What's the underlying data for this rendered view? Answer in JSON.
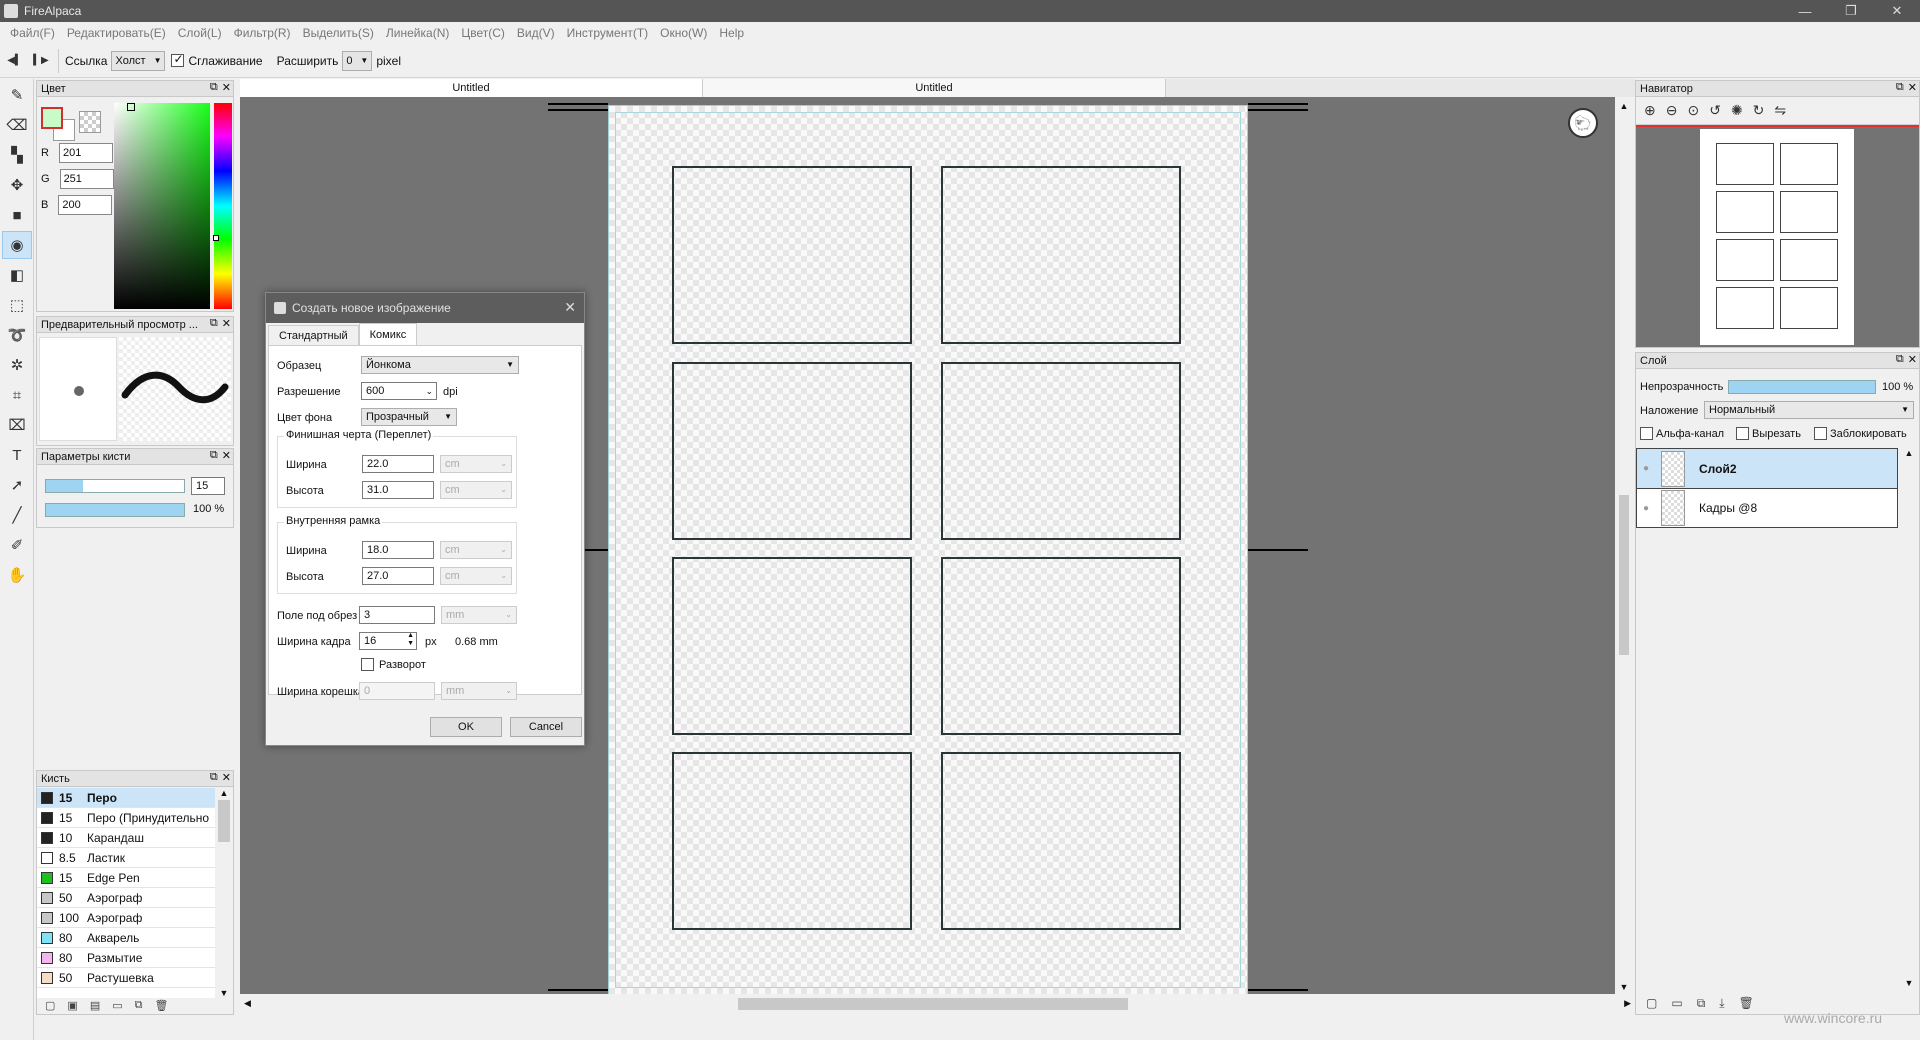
{
  "window": {
    "title": "FireAlpaca",
    "minimize": "—",
    "restore": "❐",
    "close": "✕"
  },
  "menu": [
    "Файл(F)",
    "Редактировать(E)",
    "Слой(L)",
    "Фильтр(R)",
    "Выделить(S)",
    "Линейка(N)",
    "Цвет(C)",
    "Вид(V)",
    "Инструмент(T)",
    "Окно(W)",
    "Help"
  ],
  "tool_options": {
    "ref_label": "Ссылка",
    "ref_value": "Холст",
    "antialias_label": "Сглаживание",
    "antialias_checked": true,
    "expand_label": "Расширить",
    "expand_value": "0",
    "unit": "pixel"
  },
  "color_panel": {
    "title": "Цвет",
    "r_label": "R",
    "r": "201",
    "g_label": "G",
    "g": "251",
    "b_label": "B",
    "b": "200",
    "fg_color": "#c9fbc8"
  },
  "preview_panel": {
    "title": "Предварительный просмотр ..."
  },
  "brush_params": {
    "title": "Параметры кисти",
    "size": "15",
    "opacity": "100 %",
    "size_fraction": 0.27,
    "opacity_fraction": 1.0
  },
  "brush_panel": {
    "title": "Кисть",
    "items": [
      {
        "size": "15",
        "name": "Перо",
        "color": "#222222",
        "selected": true
      },
      {
        "size": "15",
        "name": "Перо (Принудительно",
        "color": "#222222"
      },
      {
        "size": "10",
        "name": "Карандаш",
        "color": "#222222"
      },
      {
        "size": "8.5",
        "name": "Ластик",
        "color": "#ffffff"
      },
      {
        "size": "15",
        "name": "Edge Pen",
        "color": "#1fbf1f"
      },
      {
        "size": "50",
        "name": "Аэрограф",
        "color": "#c8c8c8"
      },
      {
        "size": "100",
        "name": "Аэрограф",
        "color": "#c8c8c8"
      },
      {
        "size": "80",
        "name": "Акварель",
        "color": "#7fe3f5"
      },
      {
        "size": "80",
        "name": "Размытие",
        "color": "#f5b3f0"
      },
      {
        "size": "50",
        "name": "Растушевка",
        "color": "#f5dcc4"
      }
    ]
  },
  "doc_tabs": [
    "Untitled",
    "Untitled"
  ],
  "dialog": {
    "title": "Создать новое изображение",
    "tabs": [
      "Стандартный",
      "Комикс"
    ],
    "preset_label": "Образец",
    "preset_value": "Йонкома",
    "resolution_label": "Разрешение",
    "resolution_value": "600",
    "resolution_unit": "dpi",
    "bg_label": "Цвет фона",
    "bg_value": "Прозрачный",
    "finish_group": "Финишная черта (Переплет)",
    "finish_width_label": "Ширина",
    "finish_width": "22.0",
    "finish_height_label": "Высота",
    "finish_height": "31.0",
    "inner_group": "Внутренняя рамка",
    "inner_width_label": "Ширина",
    "inner_width": "18.0",
    "inner_height_label": "Высота",
    "inner_height": "27.0",
    "unit_cm": "cm",
    "bleed_label": "Поле под обрез",
    "bleed_value": "3",
    "unit_mm": "mm",
    "frame_width_label": "Ширина кадра",
    "frame_width_value": "16",
    "frame_width_unit": "px",
    "frame_width_mm": "0.68 mm",
    "spread_label": "Разворот",
    "spine_label": "Ширина корешка",
    "spine_value": "0",
    "ok": "OK",
    "cancel": "Cancel"
  },
  "navigator": {
    "title": "Навигатор"
  },
  "layer_panel": {
    "title": "Слой",
    "opacity_label": "Непрозрачность",
    "opacity_value": "100 %",
    "blend_label": "Наложение",
    "blend_value": "Нормальный",
    "alpha_label": "Альфа-канал",
    "clip_label": "Вырезать",
    "lock_label": "Заблокировать",
    "layers": [
      {
        "name": "Слой2",
        "selected": true
      },
      {
        "name": "Кадры @8",
        "selected": false
      }
    ]
  },
  "watermark": "www.wincore.ru",
  "colors": {
    "accent": "#cce4f7",
    "titlebar": "#555555",
    "canvas_bg": "#737373"
  }
}
